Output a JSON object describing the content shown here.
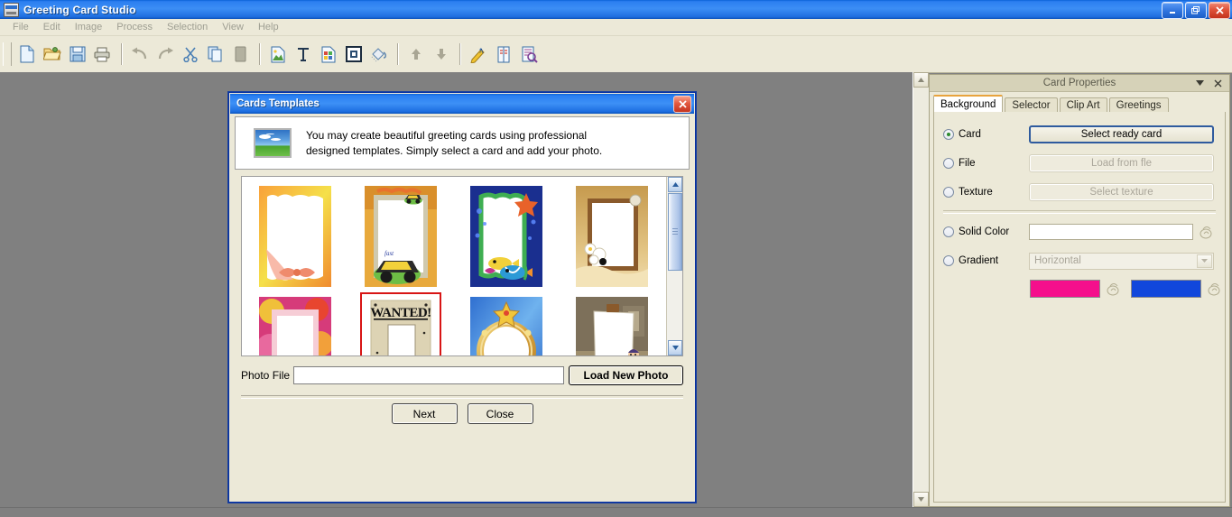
{
  "window": {
    "title": "Greeting Card Studio",
    "icon": "app-window-icon",
    "minimize_label": "Minimize",
    "restore_label": "Restore",
    "close_label": "Close"
  },
  "menubar": {
    "items": [
      {
        "label": "File"
      },
      {
        "label": "Edit"
      },
      {
        "label": "Image"
      },
      {
        "label": "Process"
      },
      {
        "label": "Selection"
      },
      {
        "label": "View"
      },
      {
        "label": "Help"
      }
    ]
  },
  "toolbar": {
    "groups": [
      [
        "new-document-icon",
        "open-folder-icon",
        "save-disk-icon",
        "print-icon"
      ],
      [
        "undo-icon",
        "redo-icon",
        "cut-scissors-icon",
        "copy-icon",
        "paste-icon"
      ],
      [
        "insert-image-icon",
        "text-tool-icon",
        "clip-art-icon",
        "frame-icon",
        "paint-bucket-icon"
      ],
      [
        "move-up-icon",
        "move-down-icon"
      ],
      [
        "spell-check-icon",
        "page-setup-icon",
        "print-preview-icon"
      ]
    ]
  },
  "dialog": {
    "title": "Cards Templates",
    "close_label": "Close dialog",
    "header_icon": "landscape-photo-icon",
    "header_text_line1": "You may create beautiful greeting cards using professional",
    "header_text_line2": "designed templates. Simply select a card and add your photo.",
    "templates": [
      {
        "name": "orange-ribbon-card",
        "selected": false
      },
      {
        "name": "race-car-card",
        "selected": false
      },
      {
        "name": "underwater-card",
        "selected": false
      },
      {
        "name": "wooden-frame-card",
        "selected": false
      },
      {
        "name": "pink-flowers-card",
        "selected": false
      },
      {
        "name": "wanted-poster-card",
        "selected": true
      },
      {
        "name": "gold-oval-frame-card",
        "selected": false
      },
      {
        "name": "painter-easel-card",
        "selected": false
      }
    ],
    "photo_file_label": "Photo File",
    "photo_file_value": "",
    "photo_file_placeholder": "",
    "load_new_photo_label": "Load New Photo",
    "next_label": "Next",
    "close_label_button": "Close",
    "scroll_up_icon": "chevron-up-icon",
    "scroll_down_icon": "chevron-down-icon"
  },
  "properties": {
    "title": "Card Properties",
    "collapse_icon": "chevron-down-icon",
    "close_icon": "close-icon",
    "tabs": [
      {
        "label": "Background",
        "active": true
      },
      {
        "label": "Selector",
        "active": false
      },
      {
        "label": "Clip Art",
        "active": false
      },
      {
        "label": "Greetings",
        "active": false
      }
    ],
    "background": {
      "options": [
        {
          "label": "Card",
          "selected": true,
          "button": "Select ready card",
          "disabled": false
        },
        {
          "label": "File",
          "selected": false,
          "button": "Load from fle",
          "disabled": true
        },
        {
          "label": "Texture",
          "selected": false,
          "button": "Select texture",
          "disabled": true
        }
      ],
      "solid_color_label": "Solid Color",
      "solid_color_selected": false,
      "solid_color_value": "",
      "gradient_label": "Gradient",
      "gradient_selected": false,
      "gradient_direction": "Horizontal",
      "gradient_color_1": "#F50F8C",
      "gradient_color_2": "#1147DC",
      "picker_icon": "color-picker-icon"
    }
  },
  "canvas": {
    "scroll_up_icon": "triangle-up-icon",
    "scroll_down_icon": "triangle-down-icon"
  }
}
